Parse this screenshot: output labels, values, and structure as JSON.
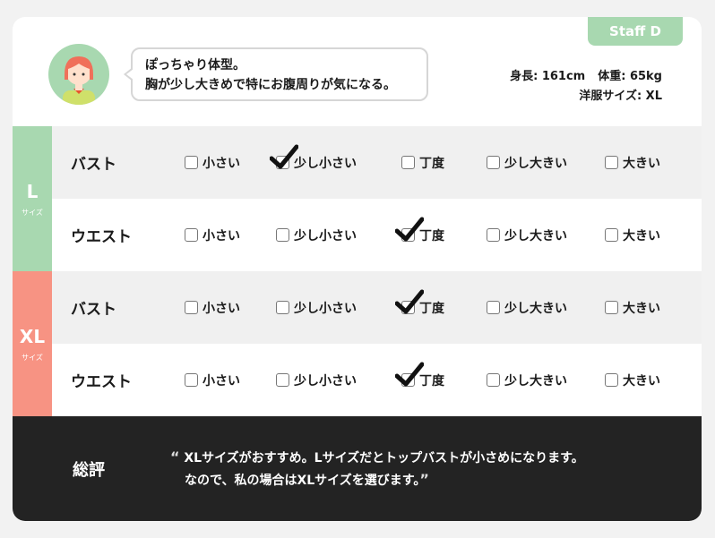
{
  "staff": {
    "label": "Staff D"
  },
  "comment": {
    "line1": "ぽっちゃり体型。",
    "line2": "胸が少し大きめで特にお腹周りが気になる。"
  },
  "stats": {
    "height": "身長: 161cm",
    "weight": "体重: 65kg",
    "size": "洋服サイズ: XL"
  },
  "options": [
    "小さい",
    "少し小さい",
    "丁度",
    "少し大きい",
    "大きい"
  ],
  "groups": [
    {
      "size": "L",
      "size_sub": "サイズ",
      "color": "#a8d8b0",
      "rows": [
        {
          "label": "バスト",
          "checked": "少し小さい"
        },
        {
          "label": "ウエスト",
          "checked": "丁度"
        }
      ]
    },
    {
      "size": "XL",
      "size_sub": "サイズ",
      "color": "#f79383",
      "rows": [
        {
          "label": "バスト",
          "checked": "丁度"
        },
        {
          "label": "ウエスト",
          "checked": "丁度"
        }
      ]
    }
  ],
  "summary": {
    "label": "総評",
    "open_quote": "“",
    "close_quote": "”",
    "line1": "XLサイズがおすすめ。Lサイズだとトップバストが小さめになります。",
    "line2": "なので、私の場合はXLサイズを選びます。"
  }
}
